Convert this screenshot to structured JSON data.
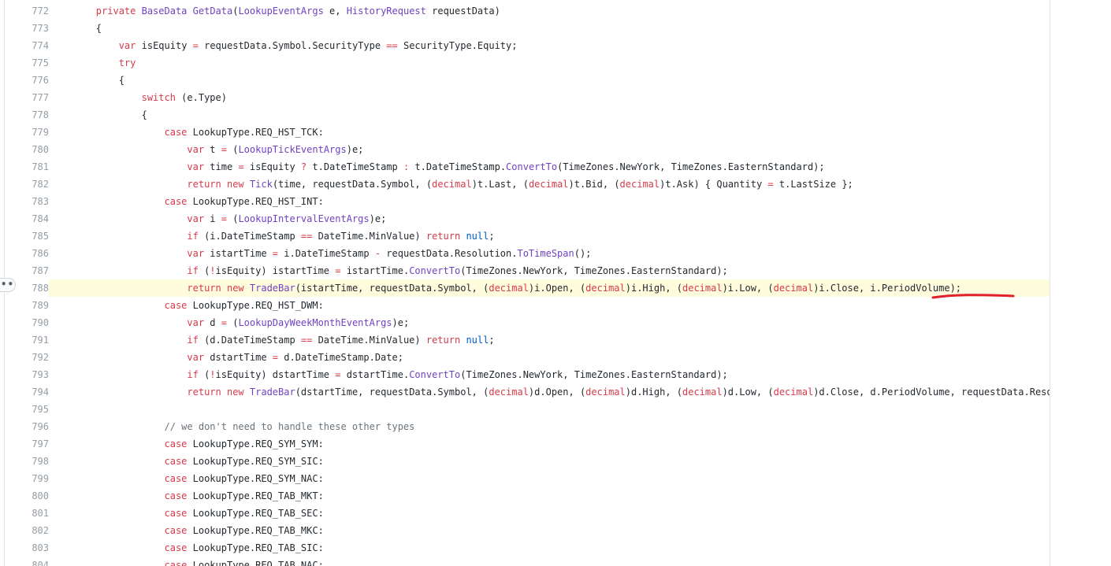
{
  "annotation_color": "#e0202a",
  "highlight_color": "#fffbdd",
  "lines": [
    {
      "n": "772",
      "tokens": [
        [
          "pl",
          "        "
        ],
        [
          "kw",
          "private"
        ],
        [
          "pl",
          " "
        ],
        [
          "typ",
          "BaseData"
        ],
        [
          "pl",
          " "
        ],
        [
          "typ",
          "GetData"
        ],
        [
          "pl",
          "("
        ],
        [
          "typ",
          "LookupEventArgs"
        ],
        [
          "pl",
          " e, "
        ],
        [
          "typ",
          "HistoryRequest"
        ],
        [
          "pl",
          " requestData)"
        ]
      ]
    },
    {
      "n": "773",
      "tokens": [
        [
          "pl",
          "        {"
        ]
      ]
    },
    {
      "n": "774",
      "tokens": [
        [
          "pl",
          "            "
        ],
        [
          "kw",
          "var"
        ],
        [
          "pl",
          " isEquity "
        ],
        [
          "op",
          "="
        ],
        [
          "pl",
          " requestData.Symbol.SecurityType "
        ],
        [
          "op",
          "=="
        ],
        [
          "pl",
          " SecurityType.Equity;"
        ]
      ]
    },
    {
      "n": "775",
      "tokens": [
        [
          "pl",
          "            "
        ],
        [
          "kw",
          "try"
        ]
      ]
    },
    {
      "n": "776",
      "tokens": [
        [
          "pl",
          "            {"
        ]
      ]
    },
    {
      "n": "777",
      "tokens": [
        [
          "pl",
          "                "
        ],
        [
          "kw",
          "switch"
        ],
        [
          "pl",
          " (e.Type)"
        ]
      ]
    },
    {
      "n": "778",
      "tokens": [
        [
          "pl",
          "                {"
        ]
      ]
    },
    {
      "n": "779",
      "tokens": [
        [
          "pl",
          "                    "
        ],
        [
          "kw",
          "case"
        ],
        [
          "pl",
          " LookupType.REQ_HST_TCK:"
        ]
      ]
    },
    {
      "n": "780",
      "tokens": [
        [
          "pl",
          "                        "
        ],
        [
          "kw",
          "var"
        ],
        [
          "pl",
          " t "
        ],
        [
          "op",
          "="
        ],
        [
          "pl",
          " ("
        ],
        [
          "typ",
          "LookupTickEventArgs"
        ],
        [
          "pl",
          ")e;"
        ]
      ]
    },
    {
      "n": "781",
      "tokens": [
        [
          "pl",
          "                        "
        ],
        [
          "kw",
          "var"
        ],
        [
          "pl",
          " time "
        ],
        [
          "op",
          "="
        ],
        [
          "pl",
          " isEquity "
        ],
        [
          "op",
          "?"
        ],
        [
          "pl",
          " t.DateTimeStamp "
        ],
        [
          "op",
          ":"
        ],
        [
          "pl",
          " t.DateTimeStamp."
        ],
        [
          "typ",
          "ConvertTo"
        ],
        [
          "pl",
          "(TimeZones.NewYork, TimeZones.EasternStandard);"
        ]
      ]
    },
    {
      "n": "782",
      "tokens": [
        [
          "pl",
          "                        "
        ],
        [
          "kw",
          "return"
        ],
        [
          "pl",
          " "
        ],
        [
          "kw",
          "new"
        ],
        [
          "pl",
          " "
        ],
        [
          "typ",
          "Tick"
        ],
        [
          "pl",
          "(time, requestData.Symbol, ("
        ],
        [
          "kw",
          "decimal"
        ],
        [
          "pl",
          ")t.Last, ("
        ],
        [
          "kw",
          "decimal"
        ],
        [
          "pl",
          ")t.Bid, ("
        ],
        [
          "kw",
          "decimal"
        ],
        [
          "pl",
          ")t.Ask) { Quantity "
        ],
        [
          "op",
          "="
        ],
        [
          "pl",
          " t.LastSize };"
        ]
      ]
    },
    {
      "n": "783",
      "tokens": [
        [
          "pl",
          "                    "
        ],
        [
          "kw",
          "case"
        ],
        [
          "pl",
          " LookupType.REQ_HST_INT:"
        ]
      ]
    },
    {
      "n": "784",
      "tokens": [
        [
          "pl",
          "                        "
        ],
        [
          "kw",
          "var"
        ],
        [
          "pl",
          " i "
        ],
        [
          "op",
          "="
        ],
        [
          "pl",
          " ("
        ],
        [
          "typ",
          "LookupIntervalEventArgs"
        ],
        [
          "pl",
          ")e;"
        ]
      ]
    },
    {
      "n": "785",
      "tokens": [
        [
          "pl",
          "                        "
        ],
        [
          "kw",
          "if"
        ],
        [
          "pl",
          " (i.DateTimeStamp "
        ],
        [
          "op",
          "=="
        ],
        [
          "pl",
          " DateTime.MinValue) "
        ],
        [
          "kw",
          "return"
        ],
        [
          "pl",
          " "
        ],
        [
          "num",
          "null"
        ],
        [
          "pl",
          ";"
        ]
      ]
    },
    {
      "n": "786",
      "tokens": [
        [
          "pl",
          "                        "
        ],
        [
          "kw",
          "var"
        ],
        [
          "pl",
          " istartTime "
        ],
        [
          "op",
          "="
        ],
        [
          "pl",
          " i.DateTimeStamp "
        ],
        [
          "op",
          "-"
        ],
        [
          "pl",
          " requestData.Resolution."
        ],
        [
          "typ",
          "ToTimeSpan"
        ],
        [
          "pl",
          "();"
        ]
      ]
    },
    {
      "n": "787",
      "tokens": [
        [
          "pl",
          "                        "
        ],
        [
          "kw",
          "if"
        ],
        [
          "pl",
          " ("
        ],
        [
          "op",
          "!"
        ],
        [
          "pl",
          "isEquity) istartTime "
        ],
        [
          "op",
          "="
        ],
        [
          "pl",
          " istartTime."
        ],
        [
          "typ",
          "ConvertTo"
        ],
        [
          "pl",
          "(TimeZones.NewYork, TimeZones.EasternStandard);"
        ]
      ]
    },
    {
      "n": "788",
      "highlight": true,
      "tokens": [
        [
          "pl",
          "                        "
        ],
        [
          "kw",
          "return"
        ],
        [
          "pl",
          " "
        ],
        [
          "kw",
          "new"
        ],
        [
          "pl",
          " "
        ],
        [
          "typ",
          "TradeBar"
        ],
        [
          "pl",
          "(istartTime, requestData.Symbol, ("
        ],
        [
          "kw",
          "decimal"
        ],
        [
          "pl",
          ")i.Open, ("
        ],
        [
          "kw",
          "decimal"
        ],
        [
          "pl",
          ")i.High, ("
        ],
        [
          "kw",
          "decimal"
        ],
        [
          "pl",
          ")i.Low, ("
        ],
        [
          "kw",
          "decimal"
        ],
        [
          "pl",
          ")i.Close, i.PeriodVolume);"
        ]
      ]
    },
    {
      "n": "789",
      "tokens": [
        [
          "pl",
          "                    "
        ],
        [
          "kw",
          "case"
        ],
        [
          "pl",
          " LookupType.REQ_HST_DWM:"
        ]
      ]
    },
    {
      "n": "790",
      "tokens": [
        [
          "pl",
          "                        "
        ],
        [
          "kw",
          "var"
        ],
        [
          "pl",
          " d "
        ],
        [
          "op",
          "="
        ],
        [
          "pl",
          " ("
        ],
        [
          "typ",
          "LookupDayWeekMonthEventArgs"
        ],
        [
          "pl",
          ")e;"
        ]
      ]
    },
    {
      "n": "791",
      "tokens": [
        [
          "pl",
          "                        "
        ],
        [
          "kw",
          "if"
        ],
        [
          "pl",
          " (d.DateTimeStamp "
        ],
        [
          "op",
          "=="
        ],
        [
          "pl",
          " DateTime.MinValue) "
        ],
        [
          "kw",
          "return"
        ],
        [
          "pl",
          " "
        ],
        [
          "num",
          "null"
        ],
        [
          "pl",
          ";"
        ]
      ]
    },
    {
      "n": "792",
      "tokens": [
        [
          "pl",
          "                        "
        ],
        [
          "kw",
          "var"
        ],
        [
          "pl",
          " dstartTime "
        ],
        [
          "op",
          "="
        ],
        [
          "pl",
          " d.DateTimeStamp.Date;"
        ]
      ]
    },
    {
      "n": "793",
      "tokens": [
        [
          "pl",
          "                        "
        ],
        [
          "kw",
          "if"
        ],
        [
          "pl",
          " ("
        ],
        [
          "op",
          "!"
        ],
        [
          "pl",
          "isEquity) dstartTime "
        ],
        [
          "op",
          "="
        ],
        [
          "pl",
          " dstartTime."
        ],
        [
          "typ",
          "ConvertTo"
        ],
        [
          "pl",
          "(TimeZones.NewYork, TimeZones.EasternStandard);"
        ]
      ]
    },
    {
      "n": "794",
      "tokens": [
        [
          "pl",
          "                        "
        ],
        [
          "kw",
          "return"
        ],
        [
          "pl",
          " "
        ],
        [
          "kw",
          "new"
        ],
        [
          "pl",
          " "
        ],
        [
          "typ",
          "TradeBar"
        ],
        [
          "pl",
          "(dstartTime, requestData.Symbol, ("
        ],
        [
          "kw",
          "decimal"
        ],
        [
          "pl",
          ")d.Open, ("
        ],
        [
          "kw",
          "decimal"
        ],
        [
          "pl",
          ")d.High, ("
        ],
        [
          "kw",
          "decimal"
        ],
        [
          "pl",
          ")d.Low, ("
        ],
        [
          "kw",
          "decimal"
        ],
        [
          "pl",
          ")d.Close, d.PeriodVolume, requestData.Resoluti"
        ]
      ]
    },
    {
      "n": "795",
      "tokens": [
        [
          "pl",
          ""
        ]
      ]
    },
    {
      "n": "796",
      "tokens": [
        [
          "pl",
          "                    "
        ],
        [
          "com",
          "// we don't need to handle these other types"
        ]
      ]
    },
    {
      "n": "797",
      "tokens": [
        [
          "pl",
          "                    "
        ],
        [
          "kw",
          "case"
        ],
        [
          "pl",
          " LookupType.REQ_SYM_SYM:"
        ]
      ]
    },
    {
      "n": "798",
      "tokens": [
        [
          "pl",
          "                    "
        ],
        [
          "kw",
          "case"
        ],
        [
          "pl",
          " LookupType.REQ_SYM_SIC:"
        ]
      ]
    },
    {
      "n": "799",
      "tokens": [
        [
          "pl",
          "                    "
        ],
        [
          "kw",
          "case"
        ],
        [
          "pl",
          " LookupType.REQ_SYM_NAC:"
        ]
      ]
    },
    {
      "n": "800",
      "tokens": [
        [
          "pl",
          "                    "
        ],
        [
          "kw",
          "case"
        ],
        [
          "pl",
          " LookupType.REQ_TAB_MKT:"
        ]
      ]
    },
    {
      "n": "801",
      "tokens": [
        [
          "pl",
          "                    "
        ],
        [
          "kw",
          "case"
        ],
        [
          "pl",
          " LookupType.REQ_TAB_SEC:"
        ]
      ]
    },
    {
      "n": "802",
      "tokens": [
        [
          "pl",
          "                    "
        ],
        [
          "kw",
          "case"
        ],
        [
          "pl",
          " LookupType.REQ_TAB_MKC:"
        ]
      ]
    },
    {
      "n": "803",
      "tokens": [
        [
          "pl",
          "                    "
        ],
        [
          "kw",
          "case"
        ],
        [
          "pl",
          " LookupType.REQ_TAB_SIC:"
        ]
      ]
    },
    {
      "n": "804",
      "tokens": [
        [
          "pl",
          "                    "
        ],
        [
          "kw",
          "case"
        ],
        [
          "pl",
          " LookupType.REQ_TAB_NAC:"
        ]
      ]
    }
  ],
  "line_menu_icon": "ellipsis-icon",
  "line_menu_label": "••"
}
